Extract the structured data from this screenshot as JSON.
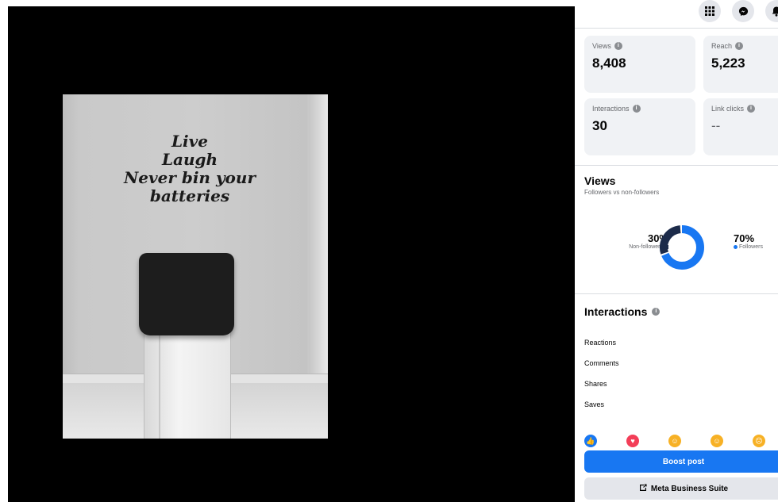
{
  "post_image": {
    "quote_lines": [
      "Live",
      "Laugh",
      "Never bin your",
      "batteries"
    ]
  },
  "topbar": {
    "icons": [
      "menu-grid-icon",
      "messenger-icon",
      "notifications-icon"
    ]
  },
  "metrics": {
    "views": {
      "label": "Views",
      "value": "8,408"
    },
    "reach": {
      "label": "Reach",
      "value": "5,223"
    },
    "interactions": {
      "label": "Interactions",
      "value": "30"
    },
    "link_clicks": {
      "label": "Link clicks",
      "value": "--"
    }
  },
  "views_section": {
    "title": "Views",
    "subtitle": "Followers vs non-followers",
    "non_followers": {
      "percent": "30%",
      "label": "Non-followers",
      "fraction": 0.3,
      "color": "#1c2b4a"
    },
    "followers": {
      "percent": "70%",
      "label": "Followers",
      "fraction": 0.7,
      "color": "#1877f2"
    }
  },
  "interactions_section": {
    "title": "Interactions",
    "rows": [
      "Reactions",
      "Comments",
      "Shares",
      "Saves"
    ]
  },
  "reactions": [
    "like-icon",
    "love-icon",
    "haha-icon",
    "wow-icon",
    "sad-icon"
  ],
  "actions": {
    "boost_label": "Boost post",
    "business_suite_label": "Meta Business Suite"
  },
  "colors": {
    "accent": "#1877f2",
    "card_bg": "#f0f2f5"
  }
}
